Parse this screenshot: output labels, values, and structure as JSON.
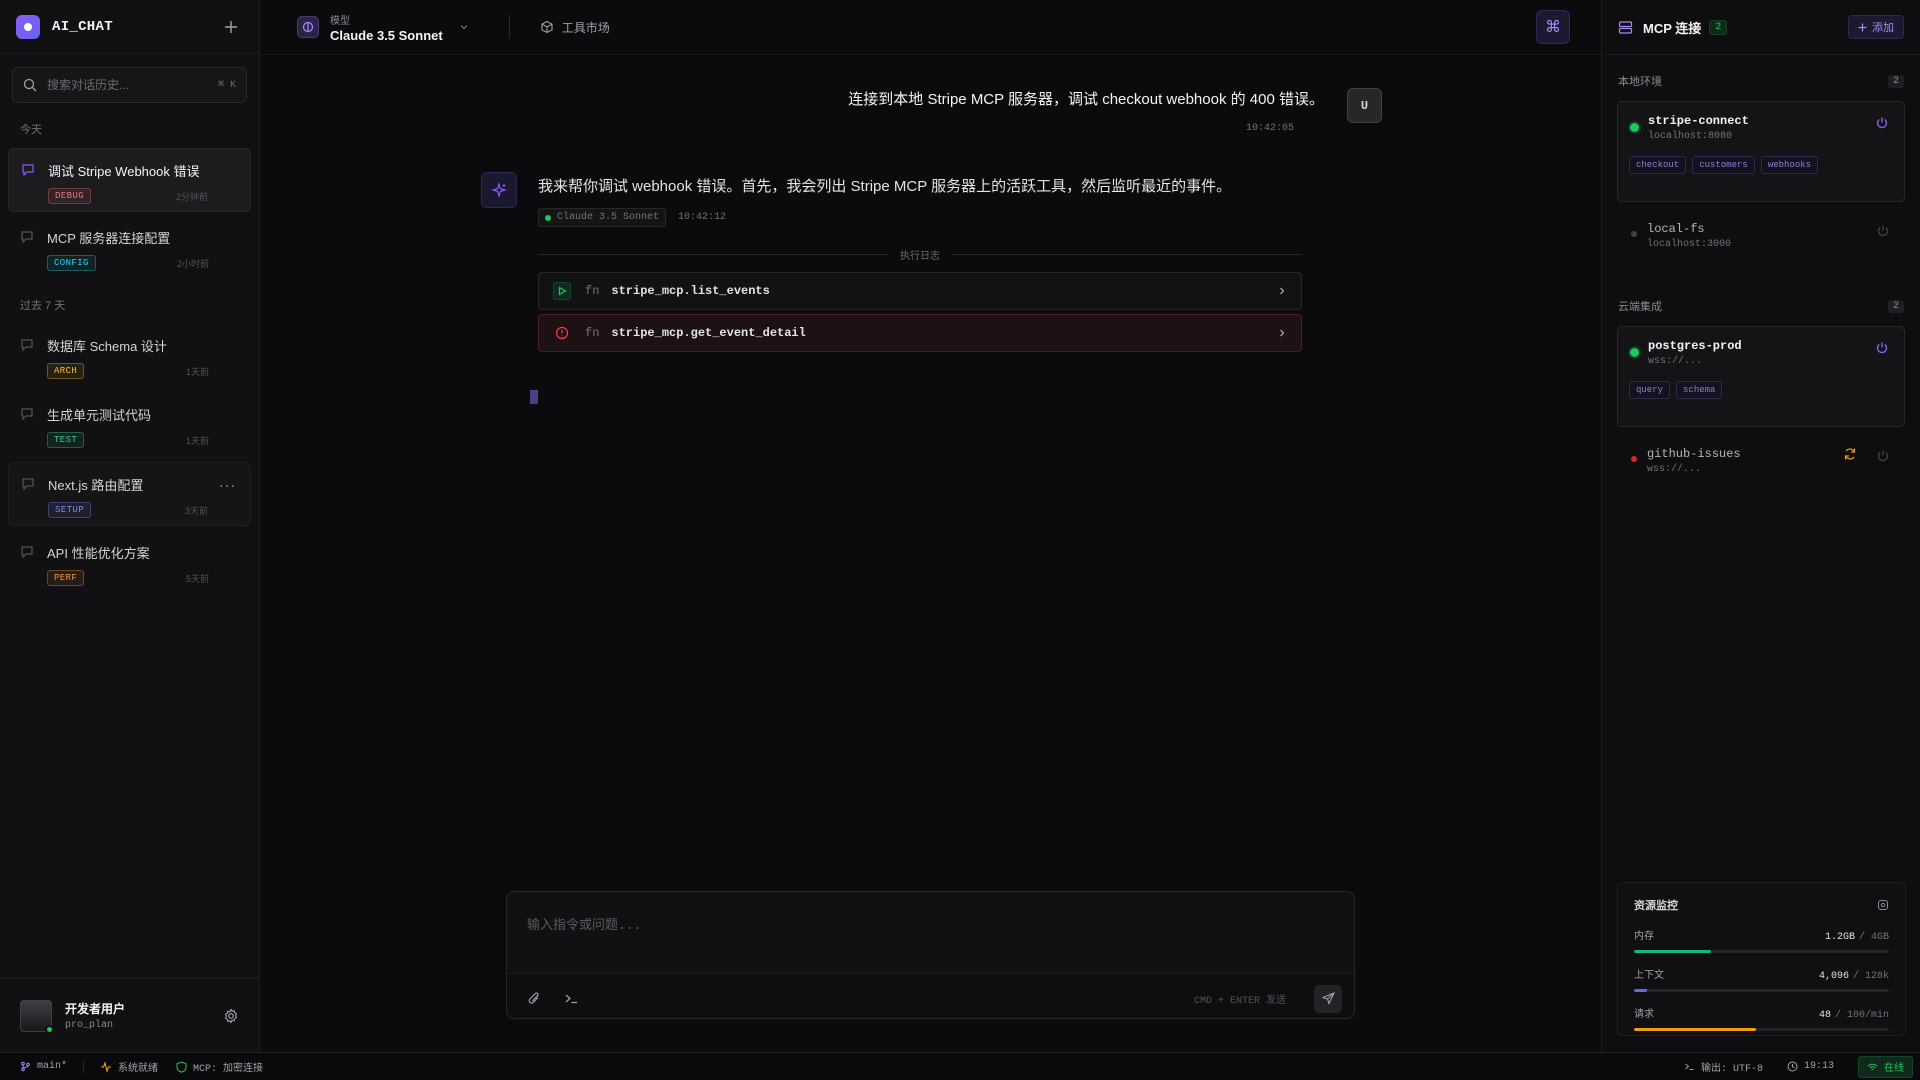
{
  "app": {
    "title": "AI_CHAT"
  },
  "sidebar": {
    "search_placeholder": "搜索对话历史...",
    "search_shortcut": "⌘ K",
    "groups": [
      {
        "label": "今天",
        "items": [
          {
            "title": "调试 Stripe Webhook 错误",
            "tag": "DEBUG",
            "tag_color": "#f87171",
            "time": "2分钟前",
            "active": true
          },
          {
            "title": "MCP 服务器连接配置",
            "tag": "CONFIG",
            "tag_color": "#22d3ee",
            "time": "2小时前"
          }
        ]
      },
      {
        "label": "过去 7 天",
        "items": [
          {
            "title": "数据库 Schema 设计",
            "tag": "ARCH",
            "tag_color": "#fbbf24",
            "time": "1天前"
          },
          {
            "title": "生成单元测试代码",
            "tag": "TEST",
            "tag_color": "#34d399",
            "time": "1天前"
          },
          {
            "title": "Next.js 路由配置",
            "tag": "SETUP",
            "tag_color": "#818cf8",
            "time": "3天前"
          },
          {
            "title": "API 性能优化方案",
            "tag": "PERF",
            "tag_color": "#fb923c",
            "time": "5天前"
          }
        ]
      }
    ],
    "more_menu": "···",
    "user": {
      "name": "开发者用户",
      "plan": "pro_plan"
    }
  },
  "header": {
    "model_label": "模型",
    "model_name": "Claude 3.5 Sonnet",
    "tool_market": "工具市场",
    "cmd_symbol": "⌘"
  },
  "chat": {
    "user_message": {
      "text": "连接到本地 Stripe MCP 服务器，调试 checkout webhook 的 400 错误。",
      "time": "10:42:05",
      "avatar": "U"
    },
    "ai_message": {
      "text": "我来帮你调试 webhook 错误。首先，我会列出 Stripe MCP 服务器上的活跃工具，然后监听最近的事件。",
      "model": "Claude 3.5 Sonnet",
      "time": "10:42:12"
    },
    "log_label": "执行日志",
    "tool_calls": [
      {
        "fn": "fn",
        "name": "stripe_mcp.list_events",
        "status": "running"
      },
      {
        "fn": "fn",
        "name": "stripe_mcp.get_event_detail",
        "status": "error"
      }
    ]
  },
  "composer": {
    "placeholder": "输入指令或问题...",
    "hint": "CMD + ENTER 发送"
  },
  "panel": {
    "title": "MCP 连接",
    "count": "2",
    "add_label": "添加",
    "sections": [
      {
        "label": "本地环境",
        "count": "2",
        "servers": [
          {
            "name": "stripe-connect",
            "host": "localhost:8080",
            "status": "connected",
            "tags": [
              "checkout",
              "customers",
              "webhooks"
            ]
          },
          {
            "name": "local-fs",
            "host": "localhost:3000",
            "status": "disconnected",
            "tags": []
          }
        ]
      },
      {
        "label": "云端集成",
        "count": "2",
        "servers": [
          {
            "name": "postgres-prod",
            "host": "wss://...",
            "status": "connected",
            "tags": [
              "query",
              "schema"
            ]
          },
          {
            "name": "github-issues",
            "host": "wss://...",
            "status": "error",
            "tags": []
          }
        ]
      }
    ],
    "monitor": {
      "title": "资源监控",
      "metrics": [
        {
          "label": "内存",
          "value": "1.2GB",
          "max": "/ 4GB",
          "fraction": 0.3,
          "color": "#10b981"
        },
        {
          "label": "上下文",
          "value": "4,096",
          "max": "/ 128k",
          "fraction": 0.05,
          "color": "#6366f1"
        },
        {
          "label": "请求",
          "value": "48",
          "max": "/ 100/min",
          "fraction": 0.48,
          "color": "#f59e0b"
        }
      ]
    }
  },
  "statusbar": {
    "branch": "main*",
    "system": "系统就绪",
    "mcp": "MCP: 加密连接",
    "output": "输出: UTF-8",
    "time": "19:13",
    "online": "在线"
  },
  "colors": {
    "accent": "#8b5cf6",
    "success": "#22c55e",
    "error": "#dc2626",
    "warning": "#f59e0b"
  }
}
